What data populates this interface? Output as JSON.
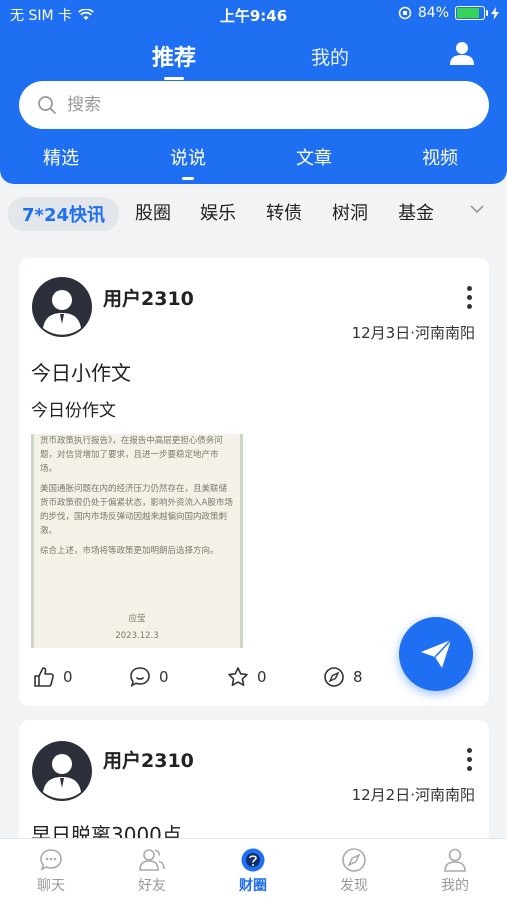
{
  "status_bar": {
    "carrier": "无 SIM 卡",
    "time": "上午9:46",
    "battery": "84%",
    "battery_level": 0.84
  },
  "top_nav": {
    "tabs": [
      {
        "label": "推荐",
        "active": true
      },
      {
        "label": "我的",
        "active": false
      }
    ],
    "user_icon": "user-icon"
  },
  "search": {
    "placeholder": "搜索"
  },
  "sub_tabs": [
    {
      "label": "精选"
    },
    {
      "label": "说说",
      "active": true
    },
    {
      "label": "文章"
    },
    {
      "label": "视频"
    }
  ],
  "categories": [
    {
      "label": "7*24快讯",
      "active": true
    },
    {
      "label": "股圈"
    },
    {
      "label": "娱乐"
    },
    {
      "label": "转债"
    },
    {
      "label": "树洞"
    },
    {
      "label": "基金"
    }
  ],
  "posts": [
    {
      "username": "用户2310",
      "date_location": "12月3日·河南南阳",
      "title": "今日小作文",
      "body": "今日份作文",
      "image_text": {
        "p1": "货币政策执行报告》，在报告中高层更担心债务问题，对信贷增加了要求，且进一步要稳定地产市场。",
        "p2": "美国通胀问题在内的经济压力仍然存在，且美联储货币政策很仍处于偏紧状态，影响外资流入A股市场的步伐，国内市场反弹动因越来越偏向国内政策刺激。",
        "p3": "综合上述，市场将等政策更加明朗后选择方向。",
        "signature": "应莹",
        "date": "2023.12.3"
      },
      "likes": "0",
      "comments": "0",
      "favorites": "0",
      "shares": "8"
    },
    {
      "username": "用户2310",
      "date_location": "12月2日·河南南阳",
      "title": "早日脱离3000点"
    }
  ],
  "bottom_tabs": [
    {
      "label": "聊天",
      "icon": "chat-icon"
    },
    {
      "label": "好友",
      "icon": "friends-icon"
    },
    {
      "label": "财圈",
      "icon": "finance-circle-icon",
      "active": true
    },
    {
      "label": "发现",
      "icon": "compass-icon"
    },
    {
      "label": "我的",
      "icon": "profile-icon"
    }
  ],
  "colors": {
    "brand": "#1f6ff2",
    "background": "#f2f3f5"
  }
}
